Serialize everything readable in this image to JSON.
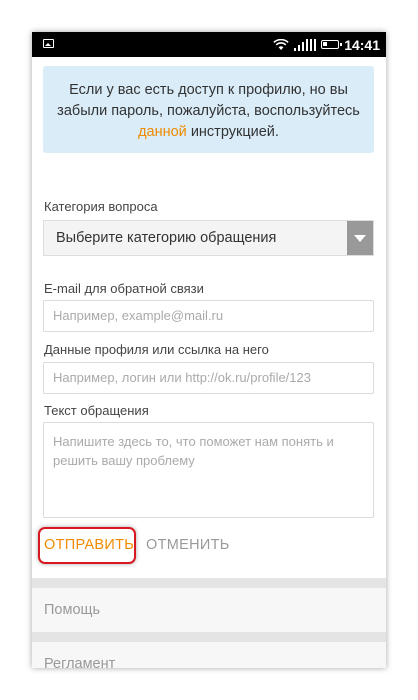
{
  "status_bar": {
    "time": "14:41",
    "icons": [
      "image-icon",
      "wifi-icon",
      "signal-icon",
      "battery-icon"
    ]
  },
  "info": {
    "text_before": "Если у вас есть доступ к профилю, но вы забыли пароль, пожалуйста, воспользуйтесь ",
    "link": "данной",
    "text_after": " инструкцией."
  },
  "form": {
    "category_label": "Категория вопроса",
    "category_selected": "Выберите категорию обращения",
    "email_label": "E-mail для обратной связи",
    "email_placeholder": "Например, example@mail.ru",
    "profile_label": "Данные профиля или ссылка на него",
    "profile_placeholder": "Например, логин или http://ok.ru/profile/123",
    "message_label": "Текст обращения",
    "message_placeholder": "Напишите здесь то, что поможет нам понять и решить вашу проблему"
  },
  "actions": {
    "send": "ОТПРАВИТЬ",
    "cancel": "ОТМЕНИТЬ"
  },
  "footer": {
    "items": [
      "Помощь",
      "Регламент"
    ]
  },
  "colors": {
    "accent": "#f08a00",
    "info_bg": "#d9ecf8",
    "highlight": "#d7191f"
  }
}
